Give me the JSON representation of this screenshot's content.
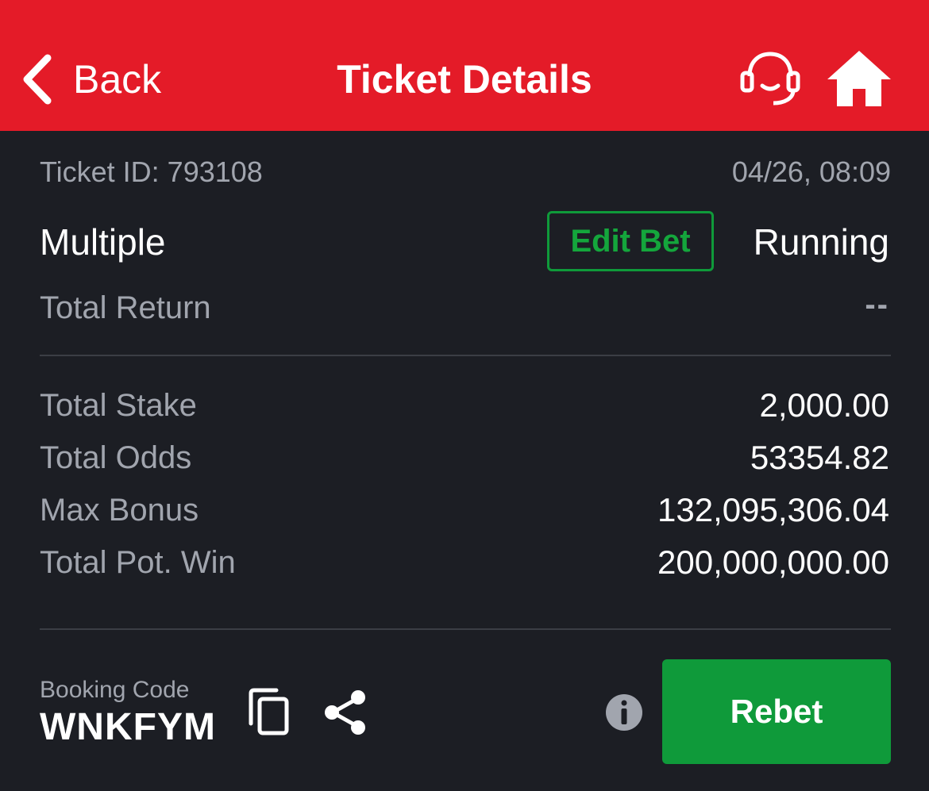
{
  "header": {
    "back_label": "Back",
    "title": "Ticket Details",
    "icons": [
      "chevron-left-icon",
      "headset-support-icon",
      "home-icon"
    ],
    "background_color": "#e41b28"
  },
  "ticket": {
    "id_text": "Ticket ID: 793108",
    "datetime": "04/26, 08:09",
    "bet_type": "Multiple",
    "edit_bet_label": "Edit Bet",
    "status": "Running",
    "total_return_label": "Total Return",
    "total_return_value": "--"
  },
  "stats": [
    {
      "label": "Total Stake",
      "value": "2,000.00"
    },
    {
      "label": "Total Odds",
      "value": "53354.82"
    },
    {
      "label": "Max Bonus",
      "value": "132,095,306.04"
    },
    {
      "label": "Total Pot. Win",
      "value": "200,000,000.00"
    }
  ],
  "booking": {
    "label": "Booking Code",
    "code": "WNKFYM",
    "icons": [
      "copy-icon",
      "share-icon",
      "info-icon"
    ]
  },
  "actions": {
    "rebet_label": "Rebet",
    "accent_color": "#0f9a3a"
  }
}
